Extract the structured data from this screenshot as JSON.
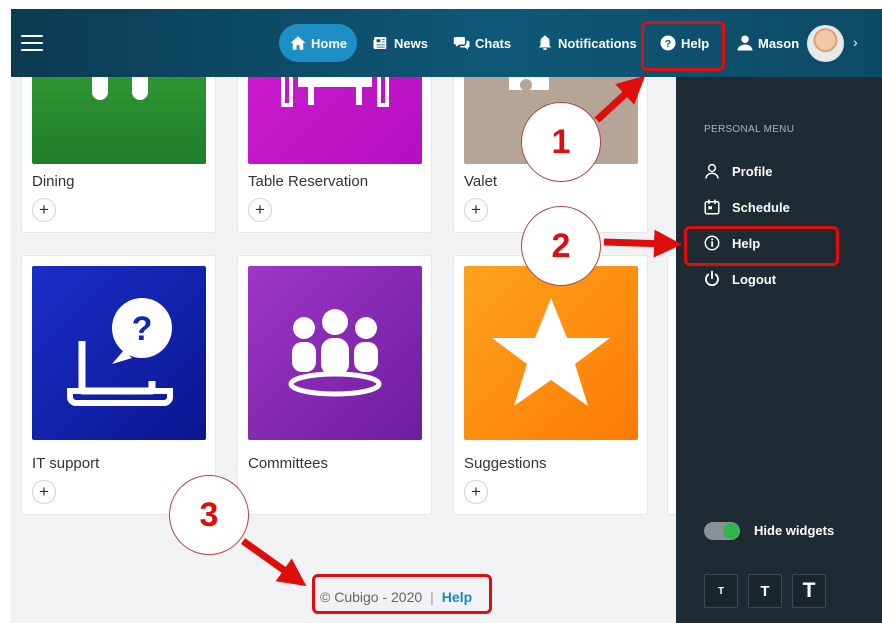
{
  "nav": {
    "home": "Home",
    "news": "News",
    "chats": "Chats",
    "notifications": "Notifications",
    "help": "Help",
    "user": "Mason",
    "chevron": "›"
  },
  "cards": [
    {
      "label": "Dining",
      "plus": "+",
      "icon": "dining-icon"
    },
    {
      "label": "Table Reservation",
      "plus": "+",
      "icon": "table-icon"
    },
    {
      "label": "Valet",
      "plus": "+",
      "icon": "valet-icon"
    },
    {
      "label": "IT support",
      "plus": "+",
      "icon": "laptop-question-icon"
    },
    {
      "label": "Committees",
      "plus": "+",
      "icon": "group-icon"
    },
    {
      "label": "Suggestions",
      "plus": "+",
      "icon": "star-icon"
    }
  ],
  "menu": {
    "title": "PERSONAL MENU",
    "items": [
      {
        "label": "Profile",
        "icon": "user-icon"
      },
      {
        "label": "Schedule",
        "icon": "calendar-icon"
      },
      {
        "label": "Help",
        "icon": "info-icon"
      },
      {
        "label": "Logout",
        "icon": "power-icon"
      }
    ],
    "hide_widgets": "Hide widgets",
    "font_sizes": [
      "T",
      "T",
      "T"
    ]
  },
  "footer": {
    "copyright": "© Cubigo - 2020",
    "separator": "|",
    "help": "Help"
  },
  "annotations": [
    "1",
    "2",
    "3"
  ],
  "colors": {
    "accent": "#1d8fc4",
    "annotation_red": "#e00d0d",
    "sidebar": "#1f2b33"
  }
}
